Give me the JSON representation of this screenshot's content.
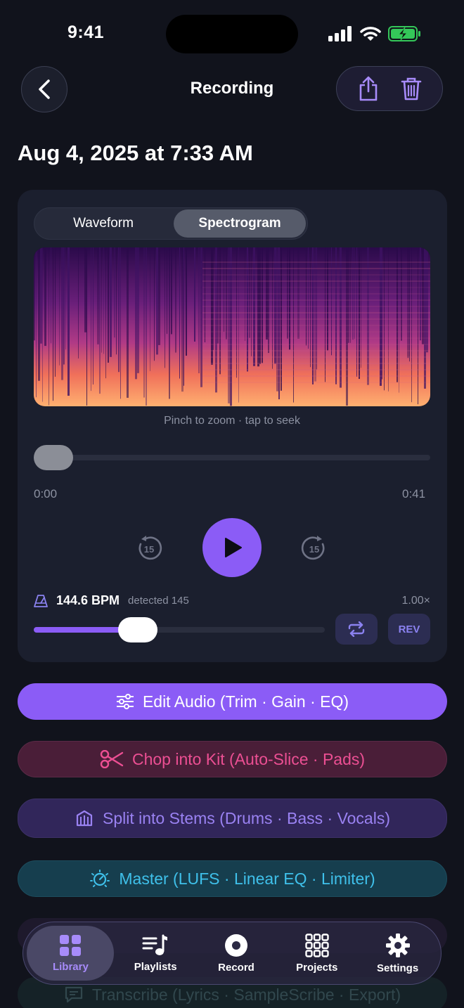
{
  "status": {
    "time": "9:41"
  },
  "header": {
    "title": "Recording"
  },
  "recording": {
    "date": "Aug 4, 2025 at 7:33 AM"
  },
  "view_toggle": {
    "options": [
      "Waveform",
      "Spectrogram"
    ],
    "selected": "Spectrogram"
  },
  "spectrogram": {
    "hint": "Pinch to zoom · tap to seek"
  },
  "playback": {
    "current": "0:00",
    "duration": "0:41",
    "position": 0.0
  },
  "tempo": {
    "bpm": "144.6 BPM",
    "detected": "detected 145",
    "speed": "1.00×",
    "rate_level": 0.32,
    "rev_label": "REV"
  },
  "actions": {
    "edit": "Edit Audio (Trim · Gain · EQ)",
    "chop": "Chop into Kit (Auto-Slice · Pads)",
    "split": "Split into Stems (Drums · Bass · Vocals)",
    "master": "Master (LUFS · Linear EQ · Limiter)",
    "transcribe": "Transcribe (Lyrics · SampleScribe · Export)"
  },
  "tabs": [
    {
      "label": "Library",
      "icon": "grid-icon",
      "active": true
    },
    {
      "label": "Playlists",
      "icon": "playlist-icon",
      "active": false
    },
    {
      "label": "Record",
      "icon": "record-icon",
      "active": false
    },
    {
      "label": "Projects",
      "icon": "projects-grid-icon",
      "active": false
    },
    {
      "label": "Settings",
      "icon": "gear-icon",
      "active": false
    }
  ],
  "colors": {
    "accent": "#8b5cf6",
    "background": "#11131c",
    "card": "#1b1f2e"
  }
}
